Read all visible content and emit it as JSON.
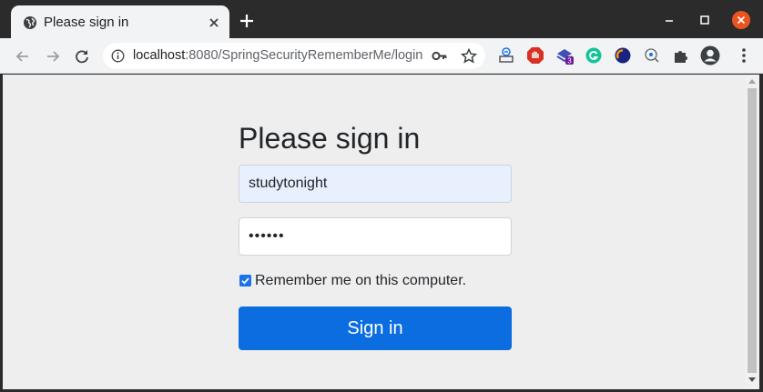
{
  "tab": {
    "title": "Please sign in"
  },
  "toolbar": {
    "url_host": "localhost",
    "url_rest": ":8080/SpringSecurityRememberMe/login",
    "extension_badge": "3"
  },
  "form": {
    "heading": "Please sign in",
    "username_value": "studytonight",
    "password_mask": "••••••",
    "remember_checked": true,
    "remember_label": "Remember me on this computer.",
    "signin_label": "Sign in"
  },
  "colors": {
    "accent": "#0b6ddf",
    "autofill_bg": "#e8f0fe",
    "close_button": "#e95420"
  },
  "icons": {
    "favicon": "globe-icon",
    "site_info": "info-icon",
    "password_key": "key-icon",
    "bookmark": "star-icon",
    "extensions": "puzzle-icon",
    "profile": "avatar-icon",
    "menu": "kebab-menu-icon"
  }
}
